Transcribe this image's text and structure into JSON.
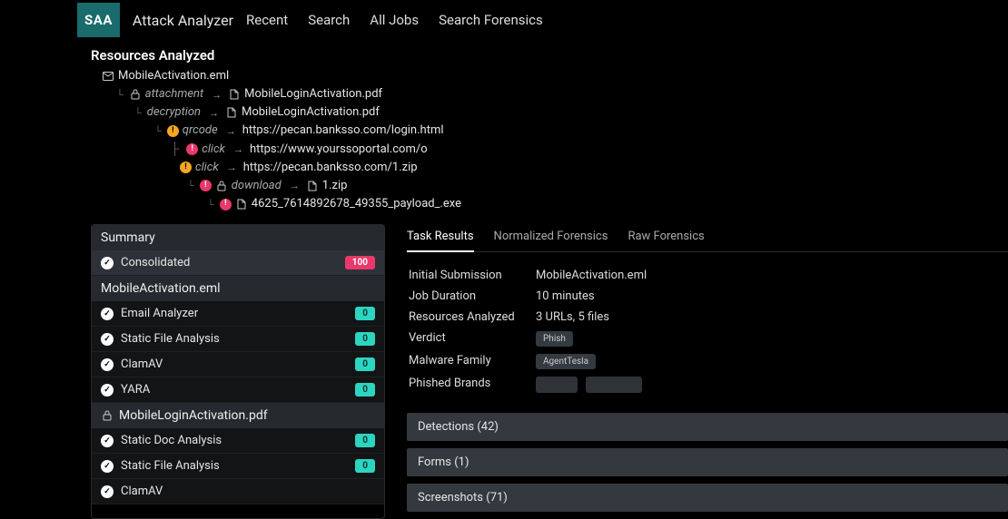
{
  "logo": "SAA",
  "app_title": "Attack Analyzer",
  "nav": [
    "Recent",
    "Search",
    "All Jobs",
    "Search Forensics"
  ],
  "resources_header": "Resources Analyzed",
  "tree": {
    "root": "MobileActivation.eml",
    "attachment_label": "attachment",
    "attachment_value": "MobileLoginActivation.pdf",
    "decryption_label": "decryption",
    "decryption_value": "MobileLoginActivation.pdf",
    "qrcode_label": "qrcode",
    "qrcode_value": "https://pecan.banksso.com/login.html",
    "click1_label": "click",
    "click1_value": "https://www.yourssoportal.com/o",
    "click2_label": "click",
    "click2_value": "https://pecan.banksso.com/1.zip",
    "download_label": "download",
    "download_value": "1.zip",
    "payload": "4625_7614892678_49355_payload_.exe"
  },
  "sidebar": {
    "summary_header": "Summary",
    "consolidated": {
      "label": "Consolidated",
      "score": "100"
    },
    "group1_header": "MobileActivation.eml",
    "group1_items": [
      {
        "label": "Email Analyzer",
        "score": "0"
      },
      {
        "label": "Static File Analysis",
        "score": "0"
      },
      {
        "label": "ClamAV",
        "score": "0"
      },
      {
        "label": "YARA",
        "score": "0"
      }
    ],
    "group2_header": "MobileLoginActivation.pdf",
    "group2_items": [
      {
        "label": "Static Doc Analysis",
        "score": "0"
      },
      {
        "label": "Static File Analysis",
        "score": "0"
      },
      {
        "label": "ClamAV",
        "score": ""
      }
    ]
  },
  "tabs": [
    "Task Results",
    "Normalized Forensics",
    "Raw Forensics"
  ],
  "details": {
    "submission_label": "Initial Submission",
    "submission_value": "MobileActivation.eml",
    "duration_label": "Job Duration",
    "duration_value": "10 minutes",
    "resources_label": "Resources Analyzed",
    "resources_value": "3 URLs, 5 files",
    "verdict_label": "Verdict",
    "verdict_value": "Phish",
    "family_label": "Malware Family",
    "family_value": "AgentTesla",
    "brands_label": "Phished Brands"
  },
  "accordions": {
    "detections": "Detections (42)",
    "forms": "Forms (1)",
    "screenshots": "Screenshots (71)"
  }
}
